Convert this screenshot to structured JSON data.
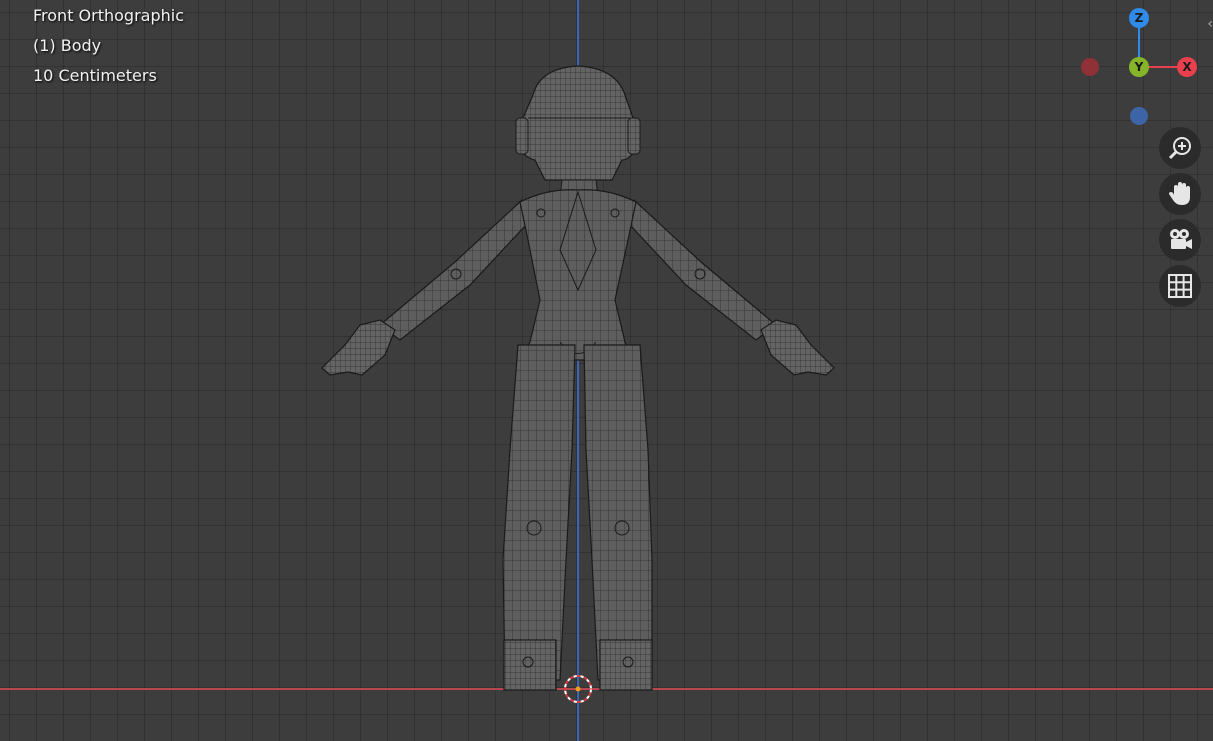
{
  "viewport": {
    "view_name": "Front Orthographic",
    "object_name": "(1) Body",
    "grid_scale": "10 Centimeters"
  },
  "gizmo": {
    "z_label": "Z",
    "y_label": "Y",
    "x_label": "X",
    "colors": {
      "x": "#e8404f",
      "y": "#87b52a",
      "z": "#2f8ae8",
      "neg_x": "#8f3137",
      "neg_z": "#3e64a8"
    }
  },
  "tools": [
    "zoom-icon",
    "hand-pan-icon",
    "camera-icon",
    "grid-icon"
  ],
  "colors": {
    "background": "#3d3d3d",
    "x_axis": "#b8484f",
    "z_axis": "#3b64b9",
    "mesh": "#5a5a5a",
    "wire": "#1a1a1a"
  }
}
